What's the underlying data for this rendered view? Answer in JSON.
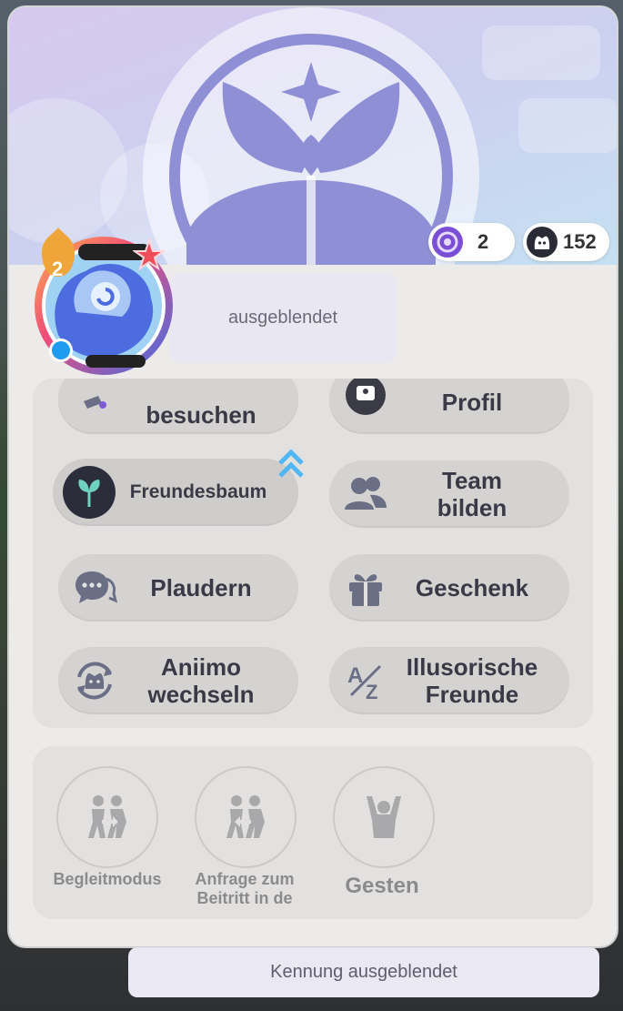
{
  "stats": {
    "gem_count": "2",
    "friend_count": "152",
    "gem_icon": "swirl-gem-icon",
    "friend_icon": "aniimo-face-icon"
  },
  "profile": {
    "level": "2",
    "name_hidden": "ausgeblendet",
    "id_hidden": "Kennung ausgeblendet"
  },
  "actions": {
    "top_left_partial": "besuchen",
    "top_right_partial": "Profil",
    "friend_tree": "Freundesbaum",
    "team_line1": "Team",
    "team_line2": "bilden",
    "chat": "Plaudern",
    "gift": "Geschenk",
    "aniimo_line1": "Aniimo",
    "aniimo_line2": "wechseln",
    "illusory_line1": "Illusorische",
    "illusory_line2": "Freunde"
  },
  "social": {
    "companion": "Begleitmodus",
    "join_line1": "Anfrage zum",
    "join_line2": "Beitritt in de",
    "gestures": "Gesten"
  },
  "colors": {
    "accent_blue": "#4fb7f5",
    "icon_gray": "#6a6f86",
    "banner_purple": "#c7b9eb"
  }
}
